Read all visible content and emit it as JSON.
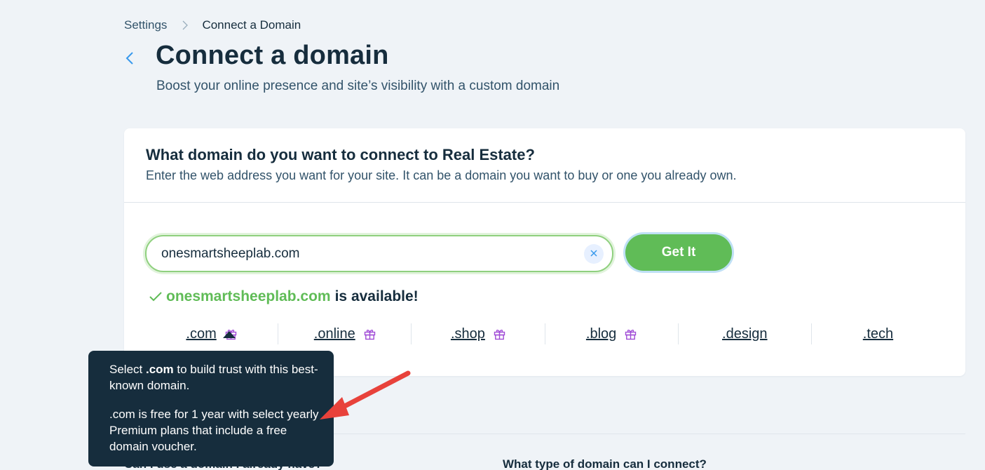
{
  "breadcrumb": {
    "root": "Settings",
    "current": "Connect a Domain"
  },
  "header": {
    "title": "Connect a domain",
    "subtitle": "Boost your online presence and site’s visibility with a custom domain"
  },
  "card": {
    "title": "What domain do you want to connect to Real Estate?",
    "description": "Enter the web address you want for your site. It can be a domain you want to buy or one you already own."
  },
  "search": {
    "value": "onesmartsheeplab.com",
    "button_label": "Get It"
  },
  "availability": {
    "domain": "onesmartsheeplab.com",
    "status": "is available!"
  },
  "tlds": [
    {
      "label": ".com",
      "gift": true
    },
    {
      "label": ".online",
      "gift": true
    },
    {
      "label": ".shop",
      "gift": true
    },
    {
      "label": ".blog",
      "gift": true
    },
    {
      "label": ".design",
      "gift": false
    },
    {
      "label": ".tech",
      "gift": false
    }
  ],
  "tooltip": {
    "line1_prefix": "Select ",
    "line1_bold": ".com",
    "line1_suffix": " to build trust with this best-known domain.",
    "line2": ".com is free for 1 year with select yearly Premium plans that include a free domain voucher."
  },
  "faq": {
    "left": "Can I use a domain I already have?",
    "right": "What type of domain can I connect?"
  },
  "colors": {
    "accent_green": "#60bc57",
    "primary_text": "#162d3d",
    "link_blue": "#3899ec",
    "gift_purple": "#a04bd6",
    "annotation_red": "#e8423b"
  }
}
